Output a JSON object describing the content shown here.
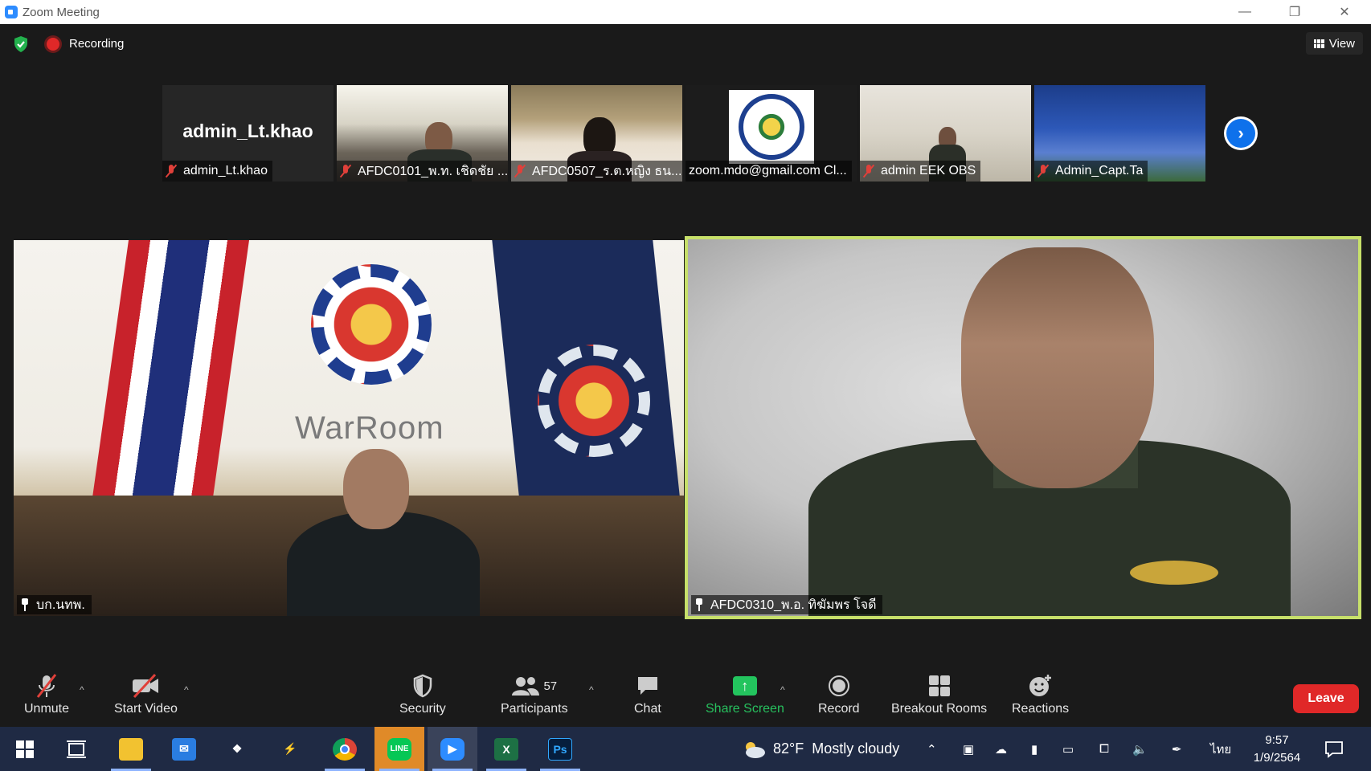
{
  "window": {
    "title": "Zoom Meeting"
  },
  "meeting": {
    "recording_label": "Recording",
    "view_label": "View"
  },
  "thumbnails": [
    {
      "name": "admin_Lt.khao",
      "big_name": "admin_Lt.khao"
    },
    {
      "name": "AFDC0101_พ.ท. เชิดชัย ..."
    },
    {
      "name": "AFDC0507_ร.ต.หญิง ธน..."
    },
    {
      "name": "zoom.mdo@gmail.com Cl..."
    },
    {
      "name": "admin EEK OBS"
    },
    {
      "name": "Admin_Capt.Ta"
    }
  ],
  "main_videos": {
    "left": {
      "name": "บก.นทพ.",
      "sign_text": "WarRoom"
    },
    "right": {
      "name": "AFDC0310_พ.อ. ทิฆัมพร โจดี"
    }
  },
  "toolbar": {
    "unmute": "Unmute",
    "start_video": "Start Video",
    "security": "Security",
    "participants": "Participants",
    "participants_count": "57",
    "chat": "Chat",
    "share_screen": "Share Screen",
    "record": "Record",
    "breakout_rooms": "Breakout Rooms",
    "reactions": "Reactions",
    "leave": "Leave"
  },
  "taskbar": {
    "weather_temp": "82°F",
    "weather_desc": "Mostly cloudy",
    "language": "ไทย",
    "time": "9:57",
    "date": "1/9/2564"
  },
  "colors": {
    "accent_green": "#27c15e",
    "active_speaker_border": "#c7e06a",
    "leave_red": "#e02828",
    "zoom_blue": "#0e71eb"
  }
}
